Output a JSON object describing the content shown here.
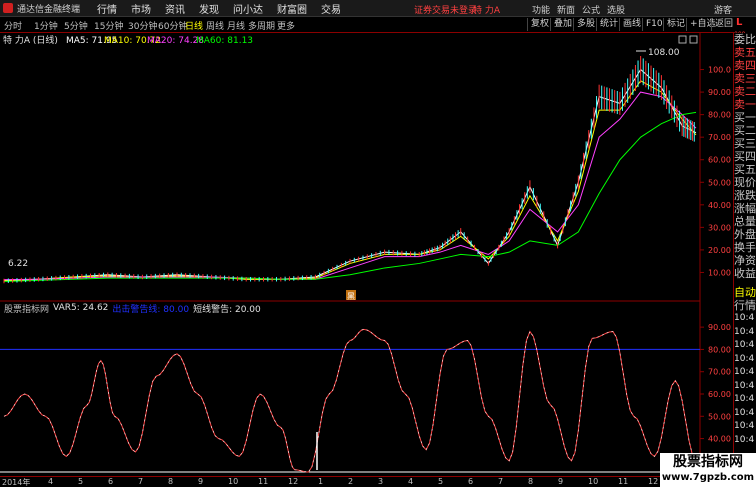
{
  "app": {
    "title": "通达信金融终端",
    "menu": [
      "行情",
      "市场",
      "资讯",
      "发现",
      "问小达",
      "财富圈",
      "交易"
    ],
    "login_notice": "证券交易未登录",
    "stock_name": "特 力A",
    "top_right": [
      "功能",
      "新面",
      "公式",
      "选股",
      "游客"
    ]
  },
  "toolbar": {
    "periods": [
      "分时",
      "1分钟",
      "5分钟",
      "15分钟",
      "30分钟",
      "60分钟",
      "日线",
      "周线",
      "月线",
      "多周期",
      "更多"
    ],
    "active_period": "日线",
    "buttons": [
      "复权",
      "叠加",
      "多股",
      "统计",
      "画线",
      "F10",
      "标记",
      "+自选",
      "返回"
    ]
  },
  "main_chart": {
    "stock_label": "特 力A (日线)",
    "ma": [
      {
        "name": "MA5",
        "value": "71.95",
        "color": "#ffffff"
      },
      {
        "name": "MA10",
        "value": "70.72",
        "color": "#ffff00"
      },
      {
        "name": "MA20",
        "value": "74.28",
        "color": "#ff40ff"
      },
      {
        "name": "MA60",
        "value": "81.13",
        "color": "#00ff00"
      }
    ],
    "high_marker": "108.00",
    "low_marker": "6.22",
    "event_marker": "黑"
  },
  "indicator": {
    "name": "股票指标网",
    "var": "VAR5: 24.62",
    "blue_text": "出击警告线: 80.00",
    "blue_line": "短线警告: 20.00"
  },
  "right_panel": {
    "badge": "L",
    "badge_sub": "000",
    "labels": [
      "委比",
      "卖五",
      "卖四",
      "卖三",
      "卖二",
      "卖一",
      "买一",
      "买二",
      "买三",
      "买四",
      "买五",
      "现价",
      "涨跌",
      "涨幅",
      "总量",
      "外盘",
      "换手",
      "净资",
      "收益"
    ],
    "sub_labels": [
      "自动",
      "行情"
    ],
    "times": [
      "10:4",
      "10:4",
      "10:4",
      "10:4",
      "10:4",
      "10:4",
      "10:4",
      "10:4",
      "10:4",
      "10:4"
    ]
  },
  "dates": [
    "2014年",
    "4",
    "5",
    "6",
    "7",
    "8",
    "9",
    "10",
    "11",
    "12",
    "1",
    "2",
    "3",
    "4",
    "5",
    "6",
    "7",
    "8",
    "9",
    "10",
    "11",
    "12",
    "1"
  ],
  "chart_data": [
    {
      "type": "line",
      "title": "特 力A (日线)",
      "ylim": [
        0,
        110
      ],
      "yticks": [
        "100.0",
        "90.00",
        "80.00",
        "70.00",
        "60.00",
        "50.00",
        "40.00",
        "30.00",
        "20.00",
        "10.00"
      ],
      "x": [
        0,
        5,
        10,
        15,
        20,
        25,
        30,
        35,
        40,
        45,
        50,
        55,
        60,
        63,
        66,
        70,
        73,
        76,
        80,
        83,
        86,
        89,
        92,
        95,
        98,
        100
      ],
      "series": [
        {
          "name": "MA5",
          "color": "#ffffff",
          "values": [
            6.22,
            7,
            8,
            9,
            8,
            9,
            8,
            7,
            7,
            8,
            15,
            19,
            18,
            21,
            28,
            14,
            28,
            48,
            22,
            50,
            88,
            85,
            100,
            92,
            75,
            72
          ]
        },
        {
          "name": "MA10",
          "color": "#ffff00",
          "values": [
            6.5,
            7,
            8,
            8.5,
            8,
            8.5,
            8,
            7,
            7,
            7.5,
            14,
            18,
            18,
            20,
            26,
            16,
            26,
            44,
            24,
            46,
            82,
            82,
            95,
            90,
            78,
            71
          ]
        },
        {
          "name": "MA20",
          "color": "#ff40ff",
          "values": [
            6.8,
            7,
            7.5,
            8,
            8,
            8,
            8,
            7.5,
            7,
            7,
            12,
            17,
            17,
            19,
            22,
            18,
            24,
            38,
            28,
            40,
            70,
            78,
            90,
            88,
            80,
            74
          ]
        },
        {
          "name": "MA60",
          "color": "#00ff00",
          "values": [
            6,
            6.5,
            7,
            7.5,
            7.5,
            7.5,
            7.5,
            7.5,
            7,
            7,
            9,
            12,
            14,
            16,
            18,
            17,
            19,
            24,
            22,
            28,
            45,
            60,
            70,
            76,
            80,
            81
          ]
        }
      ]
    },
    {
      "type": "line",
      "title": "股票指标网",
      "ylim": [
        25,
        95
      ],
      "yticks": [
        "90.00",
        "80.00",
        "70.00",
        "60.00",
        "50.00",
        "40.00",
        "30.00"
      ],
      "x": [
        0,
        3,
        6,
        9,
        12,
        14,
        16,
        19,
        22,
        25,
        28,
        31,
        34,
        37,
        40,
        42,
        44,
        47,
        50,
        52,
        55,
        58,
        61,
        64,
        67,
        70,
        73,
        76,
        79,
        82,
        85,
        88,
        91,
        94,
        97,
        100
      ],
      "series": [
        {
          "name": "VAR5",
          "color": "#ff4040",
          "values": [
            50,
            60,
            50,
            32,
            55,
            75,
            50,
            34,
            68,
            78,
            60,
            40,
            32,
            60,
            45,
            26,
            25,
            60,
            84,
            89,
            84,
            60,
            35,
            80,
            84,
            50,
            30,
            88,
            55,
            30,
            85,
            88,
            50,
            32,
            66,
            30
          ]
        }
      ],
      "hlines": [
        {
          "value": 80,
          "color": "#2030ff"
        },
        {
          "value": 20,
          "color": "#ffffff"
        }
      ]
    }
  ]
}
